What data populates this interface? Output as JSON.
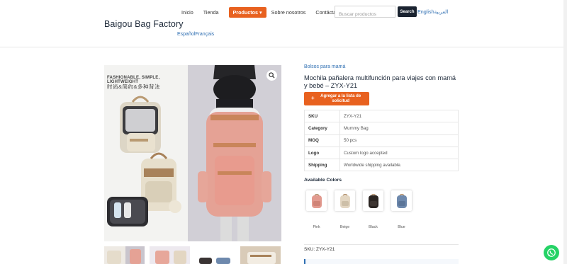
{
  "header": {
    "brand": "Baigou Bag Factory",
    "nav": [
      "Inicio",
      "Tienda",
      "Productos",
      "Sobre nosotros",
      "Contáctanos"
    ],
    "nav_active_suffix": "▾",
    "search_placeholder": "Buscar productos",
    "search_button": "Search",
    "lang_en": "English",
    "lang_ar": "العربية",
    "lang_es": "Español",
    "lang_fr": "Français"
  },
  "gallery": {
    "text_en": "FASHIONABLE, SIMPLE, LIGHTWEIGHT",
    "text_cn": "时尚&简约&多种背法"
  },
  "product": {
    "category_link": "Bolsos para mamá",
    "title": "Mochila pañalera multifunción para viajes con mamá y bebé – ZYX-Y21",
    "request_button": "Agregar a la lista de solicitud",
    "specs": [
      {
        "k": "SKU",
        "v": "ZYX-Y21"
      },
      {
        "k": "Category",
        "v": "Mummy Bag"
      },
      {
        "k": "MOQ",
        "v": "50 pcs"
      },
      {
        "k": "Logo",
        "v": "Custom logo accepted"
      },
      {
        "k": "Shipping",
        "v": "Worldwide shipping available."
      }
    ],
    "colors_title": "Available Colors",
    "colors": [
      {
        "name": "Pink",
        "hex": "#e29a8f"
      },
      {
        "name": "Beige",
        "hex": "#e3d6c2"
      },
      {
        "name": "Black",
        "hex": "#2b2522"
      },
      {
        "name": "Blue",
        "hex": "#6e89ad"
      }
    ],
    "sku_line": "SKU: ZYX-Y21"
  },
  "colors": {
    "accent": "#e8611f",
    "link": "#2f6fb2",
    "dark": "#1a2330",
    "whatsapp": "#25d366"
  }
}
